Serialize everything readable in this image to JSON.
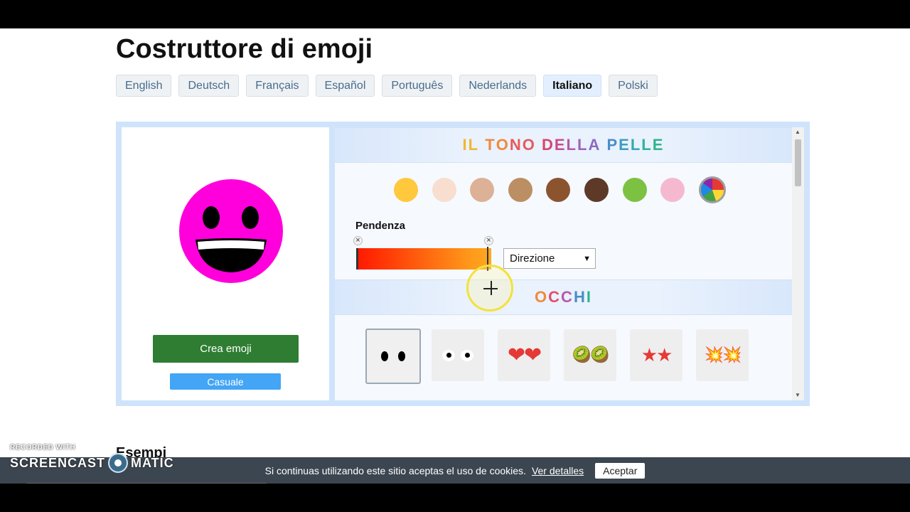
{
  "page": {
    "title": "Costruttore di emoji"
  },
  "languages": [
    {
      "label": "English",
      "active": false
    },
    {
      "label": "Deutsch",
      "active": false
    },
    {
      "label": "Français",
      "active": false
    },
    {
      "label": "Español",
      "active": false
    },
    {
      "label": "Português",
      "active": false
    },
    {
      "label": "Nederlands",
      "active": false
    },
    {
      "label": "Italiano",
      "active": true
    },
    {
      "label": "Polski",
      "active": false
    }
  ],
  "preview": {
    "face_color": "#ff00dd",
    "create_label": "Crea emoji",
    "random_label": "Casuale"
  },
  "skin_section": {
    "heading_letters": [
      {
        "ch": "I",
        "color": "#f2b632"
      },
      {
        "ch": "L",
        "color": "#f2b632"
      },
      {
        "ch": " ",
        "color": "#000"
      },
      {
        "ch": "T",
        "color": "#f08a3c"
      },
      {
        "ch": "O",
        "color": "#f08a3c"
      },
      {
        "ch": "N",
        "color": "#e65b5b"
      },
      {
        "ch": "O",
        "color": "#e65b5b"
      },
      {
        "ch": " ",
        "color": "#000"
      },
      {
        "ch": "D",
        "color": "#d8456e"
      },
      {
        "ch": "E",
        "color": "#c94d8a"
      },
      {
        "ch": "L",
        "color": "#b55aa8"
      },
      {
        "ch": "L",
        "color": "#9e62b8"
      },
      {
        "ch": "A",
        "color": "#8a6cc2"
      },
      {
        "ch": " ",
        "color": "#000"
      },
      {
        "ch": "P",
        "color": "#4a8ccc"
      },
      {
        "ch": "E",
        "color": "#3e9cc2"
      },
      {
        "ch": "L",
        "color": "#34a8b0"
      },
      {
        "ch": "L",
        "color": "#2fb29c"
      },
      {
        "ch": "E",
        "color": "#2db58c"
      }
    ],
    "swatches": [
      "#ffc83d",
      "#f7dece",
      "#dcb196",
      "#bb8f63",
      "#8b542f",
      "#5d3a28",
      "#7dc142",
      "#f5b9cf",
      "rainbow"
    ],
    "gradient_label": "Pendenza",
    "gradient_colors": [
      "#ff1a00",
      "#ffa822"
    ],
    "remove_stop_symbol": "×",
    "direction_select": "Direzione"
  },
  "eyes_section": {
    "heading_letters": [
      {
        "ch": "O",
        "color": "#f08a3c"
      },
      {
        "ch": "C",
        "color": "#e0506a"
      },
      {
        "ch": "C",
        "color": "#b55aa8"
      },
      {
        "ch": "H",
        "color": "#4a8ccc"
      },
      {
        "ch": "I",
        "color": "#2db58c"
      }
    ],
    "options": [
      {
        "name": "eyes-dots-option",
        "glyph": "",
        "selected": true
      },
      {
        "name": "eyes-round-option",
        "glyph": "",
        "selected": false
      },
      {
        "name": "eyes-hearts-option",
        "glyph": "❤❤",
        "selected": false
      },
      {
        "name": "eyes-kiwi-option",
        "glyph": "🥝🥝",
        "selected": false
      },
      {
        "name": "eyes-stars-option",
        "glyph": "★★",
        "selected": false
      },
      {
        "name": "eyes-collision-option",
        "glyph": "💥💥",
        "selected": false
      }
    ]
  },
  "examples_heading": "Esempi",
  "cookie_bar": {
    "text": "Si continuas utilizando este sitio aceptas el uso de cookies.",
    "link": "Ver detalles",
    "accept": "Aceptar"
  },
  "watermark": {
    "top": "RECORDED WITH",
    "left": "SCREENCAST",
    "right": "MATIC"
  }
}
